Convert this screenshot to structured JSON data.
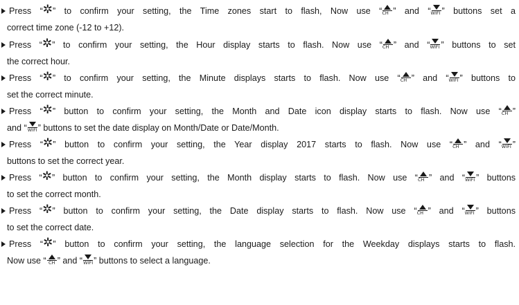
{
  "icons": {
    "gear": "✲",
    "up_arrow_label": "CH",
    "down_arrow_label": "WIFI"
  },
  "instructions": [
    {
      "lines": [
        [
          {
            "t": "Press “"
          },
          {
            "icon": "gear"
          },
          {
            "t": "” to confirm your setting, the Time zones start to flash, Now use “"
          },
          {
            "icon": "up"
          },
          {
            "t": "” and “"
          },
          {
            "icon": "down"
          },
          {
            "t": "” buttons set a"
          }
        ],
        [
          {
            "t": "correct time zone (-12 to +12)."
          }
        ]
      ]
    },
    {
      "lines": [
        [
          {
            "t": "Press “"
          },
          {
            "icon": "gear"
          },
          {
            "t": "” to confirm your setting, the Hour display starts to flash. Now use “"
          },
          {
            "icon": "up"
          },
          {
            "t": "” and “"
          },
          {
            "icon": "down"
          },
          {
            "t": "” buttons to set"
          }
        ],
        [
          {
            "t": "the correct hour."
          }
        ]
      ]
    },
    {
      "lines": [
        [
          {
            "t": "Press “"
          },
          {
            "icon": "gear"
          },
          {
            "t": "” to confirm your setting, the Minute displays starts to flash. Now use “"
          },
          {
            "icon": "up"
          },
          {
            "t": "” and “"
          },
          {
            "icon": "down"
          },
          {
            "t": "” buttons to"
          }
        ],
        [
          {
            "t": "set the correct minute."
          }
        ]
      ]
    },
    {
      "lines": [
        [
          {
            "t": "Press “"
          },
          {
            "icon": "gear"
          },
          {
            "t": "” button to confirm your setting, the Month and Date icon display starts to flash. Now use “"
          },
          {
            "icon": "up"
          },
          {
            "t": "”"
          }
        ],
        [
          {
            "t": "and “"
          },
          {
            "icon": "down"
          },
          {
            "t": "” buttons to set the date display on Month/Date or Date/Month."
          }
        ]
      ]
    },
    {
      "lines": [
        [
          {
            "t": "Press “"
          },
          {
            "icon": "gear"
          },
          {
            "t": "” button to confirm your setting, the Year display 2017 starts to flash. Now use “"
          },
          {
            "icon": "up"
          },
          {
            "t": "” and “"
          },
          {
            "icon": "down"
          },
          {
            "t": "”"
          }
        ],
        [
          {
            "t": "buttons to set the correct year."
          }
        ]
      ]
    },
    {
      "lines": [
        [
          {
            "t": "Press “"
          },
          {
            "icon": "gear"
          },
          {
            "t": "” button to confirm your setting, the Month display starts to flash. Now use “"
          },
          {
            "icon": "up"
          },
          {
            "t": "” and “"
          },
          {
            "icon": "down"
          },
          {
            "t": "” buttons"
          }
        ],
        [
          {
            "t": "to set the correct month."
          }
        ]
      ]
    },
    {
      "lines": [
        [
          {
            "t": "Press “"
          },
          {
            "icon": "gear"
          },
          {
            "t": "” button to confirm your setting, the Date display starts to flash. Now use “"
          },
          {
            "icon": "up"
          },
          {
            "t": "” and “"
          },
          {
            "icon": "down"
          },
          {
            "t": "” buttons"
          }
        ],
        [
          {
            "t": "to set the correct date."
          }
        ]
      ]
    },
    {
      "lines": [
        [
          {
            "t": "Press “"
          },
          {
            "icon": "gear"
          },
          {
            "t": "” button to confirm your setting, the language selection for the Weekday displays starts to flash."
          }
        ],
        [
          {
            "t": "Now use   “"
          },
          {
            "icon": "up"
          },
          {
            "t": "” and “"
          },
          {
            "icon": "down"
          },
          {
            "t": "” buttons to select a language."
          }
        ]
      ]
    }
  ]
}
